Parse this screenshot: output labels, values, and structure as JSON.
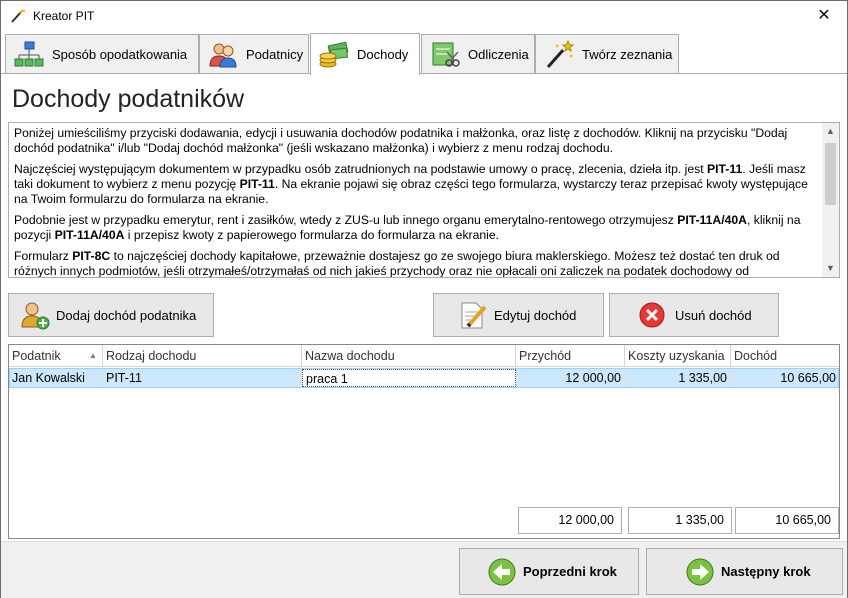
{
  "window": {
    "title": "Kreator PIT",
    "close_glyph": "✕"
  },
  "tabs": [
    {
      "label": "Sposób opodatkowania",
      "icon": "network-icon"
    },
    {
      "label": "Podatnicy",
      "icon": "users-icon"
    },
    {
      "label": "Dochody",
      "icon": "money-icon",
      "active": true
    },
    {
      "label": "Odliczenia",
      "icon": "deduction-icon"
    },
    {
      "label": "Twórz zeznania",
      "icon": "wand-icon"
    }
  ],
  "page_title": "Dochody podatników",
  "info": {
    "p1": "Poniżej umieściliśmy przyciski dodawania, edycji i usuwania dochodów podatnika i małżonka, oraz listę z dochodów. Kliknij na przycisku \"Dodaj dochód podatnika\" i/lub \"Dodaj dochód małżonka\" (jeśli wskazano małżonka) i wybierz z menu rodzaj dochodu.",
    "p2a": "Najczęściej występującym dokumentem w przypadku osób zatrudnionych na podstawie umowy o pracę, zlecenia, dzieła itp. jest ",
    "p2b": "PIT-11",
    "p2c": ". Jeśli masz taki dokument to wybierz z menu pozycję ",
    "p2d": "PIT-11",
    "p2e": ". Na ekranie pojawi się obraz części tego formularza, wystarczy teraz przepisać kwoty występujące na Twoim formularzu do formularza na ekranie.",
    "p3a": "Podobnie jest w przypadku emerytur, rent i zasiłków, wtedy z ZUS-u lub innego organu emerytalno-rentowego otrzymujesz ",
    "p3b": "PIT-11A/40A",
    "p3c": ", kliknij na pozycji ",
    "p3d": "PIT-11A/40A",
    "p3e": " i przepisz kwoty z papierowego formularza do formularza na ekranie.",
    "p4a": "Formularz ",
    "p4b": "PIT-8C",
    "p4c": " to najczęściej dochody kapitałowe, przeważnie dostajesz go ze swojego biura maklerskiego. Możesz też dostać ten druk od różnych innych podmiotów, jeśli otrzymałeś/otrzymałaś od nich jakieś przychody oraz nie opłacali oni zaliczek na podatek dochodowy od"
  },
  "buttons": {
    "add_income": "Dodaj dochód podatnika",
    "edit_income": "Edytuj dochód",
    "delete_income": "Usuń dochód",
    "prev_step": "Poprzedni krok",
    "next_step": "Następny krok"
  },
  "table": {
    "columns": [
      "Podatnik",
      "Rodzaj dochodu",
      "Nazwa dochodu",
      "Przychód",
      "Koszty uzyskania",
      "Dochód"
    ],
    "rows": [
      [
        "Jan Kowalski",
        "PIT-11",
        "praca 1",
        "12 000,00",
        "1 335,00",
        "10 665,00"
      ]
    ],
    "totals": {
      "income": "12 000,00",
      "costs": "1 335,00",
      "net": "10 665,00"
    }
  }
}
